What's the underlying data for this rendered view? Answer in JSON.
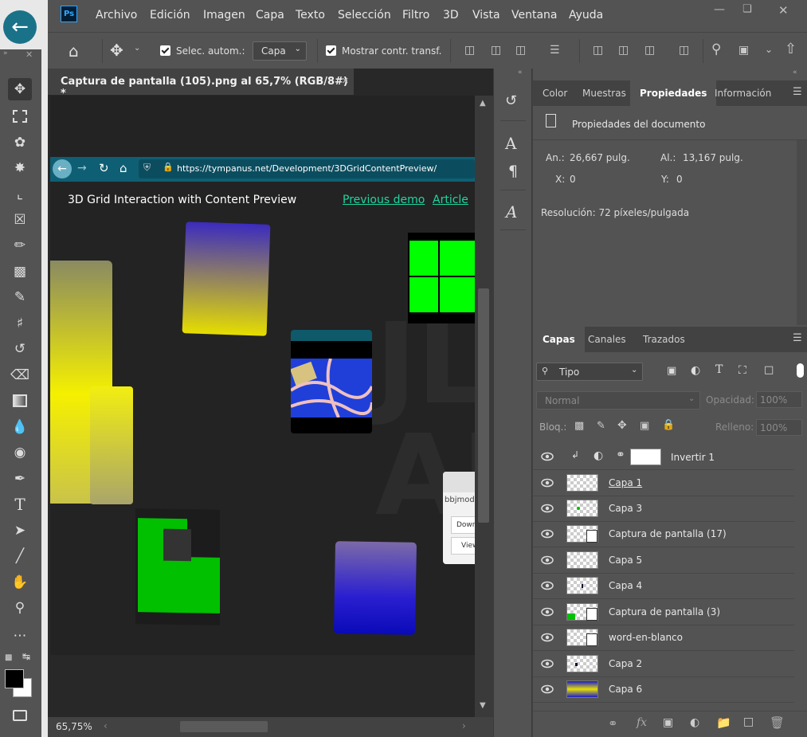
{
  "app": {
    "logo": "Ps",
    "menu": [
      "Archivo",
      "Edición",
      "Imagen",
      "Capa",
      "Texto",
      "Selección",
      "Filtro",
      "3D",
      "Vista",
      "Ventana",
      "Ayuda"
    ]
  },
  "options": {
    "auto_select_label": "Selec. autom.:",
    "auto_select_value": "Capa",
    "show_transform_label": "Mostrar contr. transf."
  },
  "document": {
    "tab_title": "Captura de pantalla (105).png al 65,7% (RGB/8#) *",
    "zoom": "65,75%"
  },
  "canvas_content": {
    "url": "https://tympanus.net/Development/3DGridContentPreview/",
    "page_title": "3D Grid Interaction with Content Preview",
    "link_prev": "Previous demo",
    "link_article": "Article",
    "bg_letters": "JL AL",
    "partial_text_1": "bbjmodif",
    "partial_text_2": "Down",
    "partial_text_3": "View"
  },
  "properties_panel": {
    "tabs": [
      "Color",
      "Muestras",
      "Propiedades",
      "Información"
    ],
    "active_tab": "Propiedades",
    "section_title": "Propiedades del documento",
    "width_label": "An.:",
    "width_value": "26,667 pulg.",
    "height_label": "Al.:",
    "height_value": "13,167 pulg.",
    "x_label": "X:",
    "x_value": "0",
    "y_label": "Y:",
    "y_value": "0",
    "resolution": "Resolución: 72 píxeles/pulgada"
  },
  "layers_panel": {
    "tabs": [
      "Capas",
      "Canales",
      "Trazados"
    ],
    "active_tab": "Capas",
    "filter_label": "Tipo",
    "blend_mode": "Normal",
    "opacity_label": "Opacidad:",
    "opacity_value": "100%",
    "lock_label": "Bloq.:",
    "fill_label": "Relleno:",
    "fill_value": "100%",
    "adjustment_layer": "Invertir 1",
    "layers": [
      {
        "name": "Capa 1",
        "thumb": "checker"
      },
      {
        "name": "Capa 3",
        "thumb": "green-dot"
      },
      {
        "name": "Captura de pantalla (17)",
        "thumb": "doc"
      },
      {
        "name": "Capa 5",
        "thumb": "checker"
      },
      {
        "name": "Capa 4",
        "thumb": "dark-dot"
      },
      {
        "name": "Captura de pantalla (3)",
        "thumb": "doc-green"
      },
      {
        "name": "word-en-blanco",
        "thumb": "doc"
      },
      {
        "name": "Capa 2",
        "thumb": "dark-dot"
      },
      {
        "name": "Capa 6",
        "thumb": "yellow-blue"
      }
    ]
  },
  "colors": {
    "panel": "#535353",
    "dark_panel": "#424242",
    "canvas_bg": "#232323",
    "browser_teal": "#0f5f74",
    "accent_green": "#00ff00",
    "link_green": "#1dd6a0"
  }
}
